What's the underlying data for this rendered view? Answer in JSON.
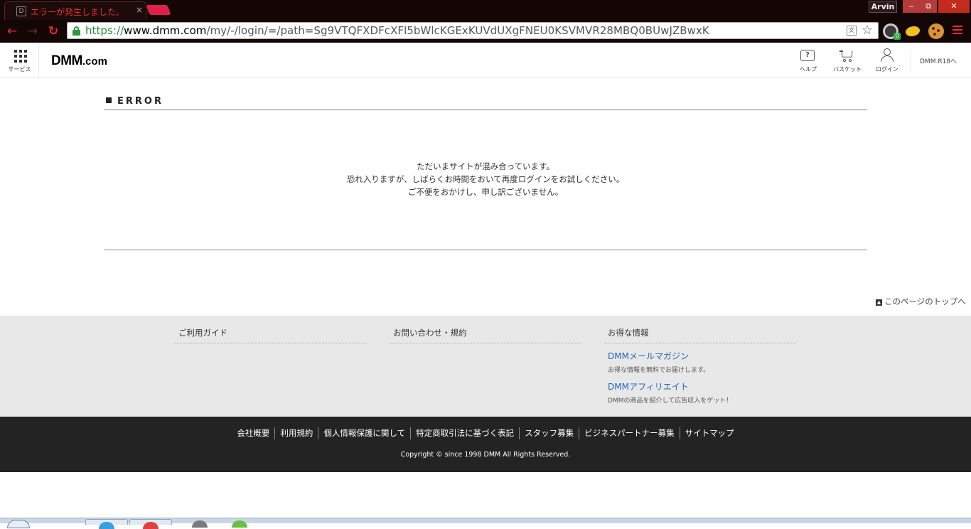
{
  "browser": {
    "tab_title": "エラーが発生しました。",
    "tab_close": "×",
    "profile_name": "Arvin",
    "url_scheme": "https://",
    "url_host": "www.dmm.com",
    "url_path": "/my/-/login/=/path=Sg9VTQFXDFcXFl5bWlcKGExKUVdUXgFNEU0KSVMVR28MBQ0BUwJZBwxK",
    "extension_badge": "0"
  },
  "header": {
    "service_label": "サービス",
    "logo_main": "DMM",
    "logo_suffix": ".com",
    "help_label": "ヘルプ",
    "basket_label": "バスケット",
    "login_label": "ログイン",
    "r18_link": "DMM.R18へ"
  },
  "main": {
    "heading": "ERROR",
    "message_lines": [
      "ただいまサイトが混み合っています。",
      "恐れ入りますが、しばらくお時間をおいて再度ログインをお試しください。",
      "ご不便をおかけし、申し訳ございません。"
    ],
    "page_top_link": "このページのトップへ"
  },
  "footer": {
    "columns": [
      {
        "title": "ご利用ガイド"
      },
      {
        "title": "お問い合わせ・規約"
      },
      {
        "title": "お得な情報",
        "items": [
          {
            "link": "DMMメールマガジン",
            "desc": "お得な情報を無料でお届けします。"
          },
          {
            "link": "DMMアフィリエイト",
            "desc": "DMMの商品を紹介して広告収入をゲット！"
          }
        ]
      }
    ],
    "nav_links": [
      "会社概要",
      "利用規約",
      "個人情報保護に関して",
      "特定商取引法に基づく表記",
      "スタッフ募集",
      "ビジネスパートナー募集",
      "サイトマップ"
    ],
    "copyright": "Copyright © since 1998 DMM All Rights Reserved."
  },
  "colors": {
    "browser_frame": "#150606",
    "browser_accent": "#e53030",
    "link_blue": "#2366b8",
    "footer_light_bg": "#e8e8e8",
    "footer_dark_bg": "#232323"
  }
}
